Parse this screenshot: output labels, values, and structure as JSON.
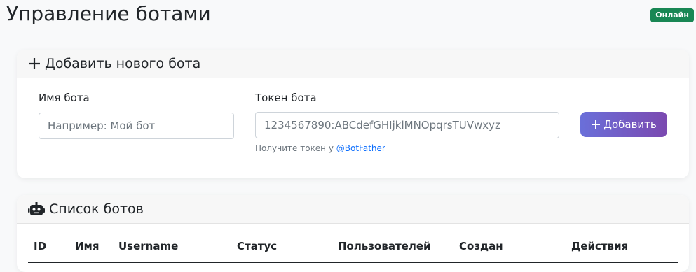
{
  "header": {
    "title": "Управление ботами",
    "status_badge": "Онлайн",
    "status_color": "#198754"
  },
  "add_bot": {
    "title": "Добавить нового бота",
    "title_icon": "plus-icon",
    "name_label": "Имя бота",
    "name_placeholder": "Например: Мой бот",
    "token_label": "Токен бота",
    "token_placeholder": "1234567890:ABCdefGHIjklMNOpqrsTUVwxyz",
    "help_prefix": "Получите токен у",
    "help_link": "@BotFather",
    "submit_label": "Добавить",
    "submit_icon": "plus-icon"
  },
  "bot_list": {
    "title": "Список ботов",
    "title_icon": "robot-icon",
    "columns": [
      "ID",
      "Имя",
      "Username",
      "Статус",
      "Пользователей",
      "Создан",
      "Действия"
    ]
  }
}
